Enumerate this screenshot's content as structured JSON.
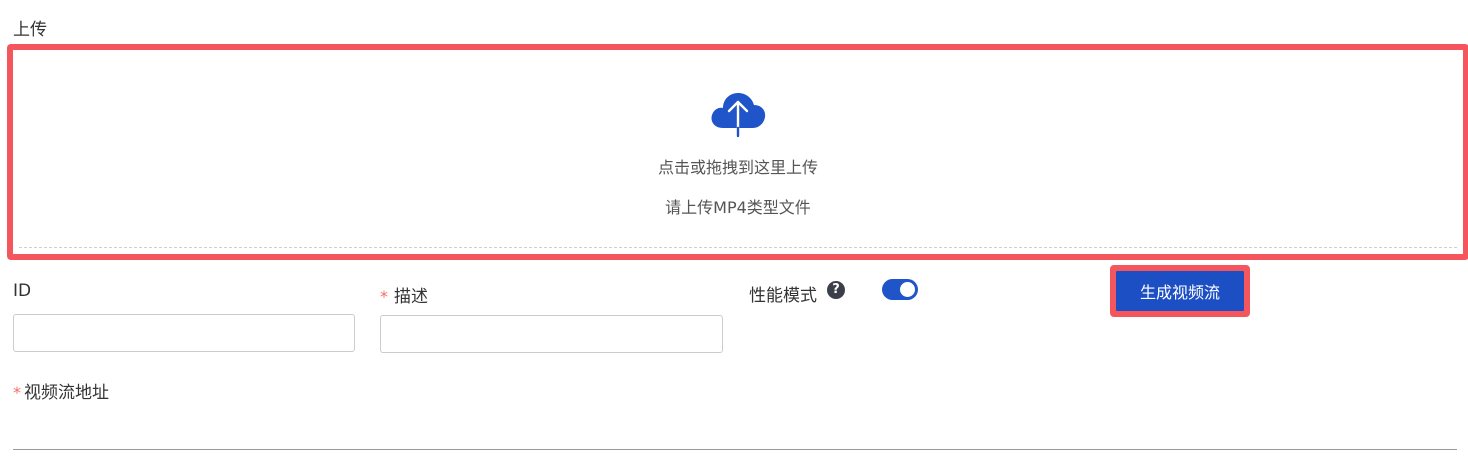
{
  "upload": {
    "section_label": "上传",
    "icon": "cloud-upload-icon",
    "main_text": "点击或拖拽到这里上传",
    "sub_text": "请上传MP4类型文件"
  },
  "form": {
    "id_label": "ID",
    "id_value": "",
    "description_label": "描述",
    "description_value": "",
    "performance_mode_label": "性能模式",
    "performance_mode_enabled": true,
    "help_icon": "?",
    "stream_address_label": "视频流地址"
  },
  "actions": {
    "generate_label": "生成视频流"
  },
  "colors": {
    "accent": "#1d4fc4",
    "highlight": "#f5555d",
    "required": "#f07066"
  }
}
